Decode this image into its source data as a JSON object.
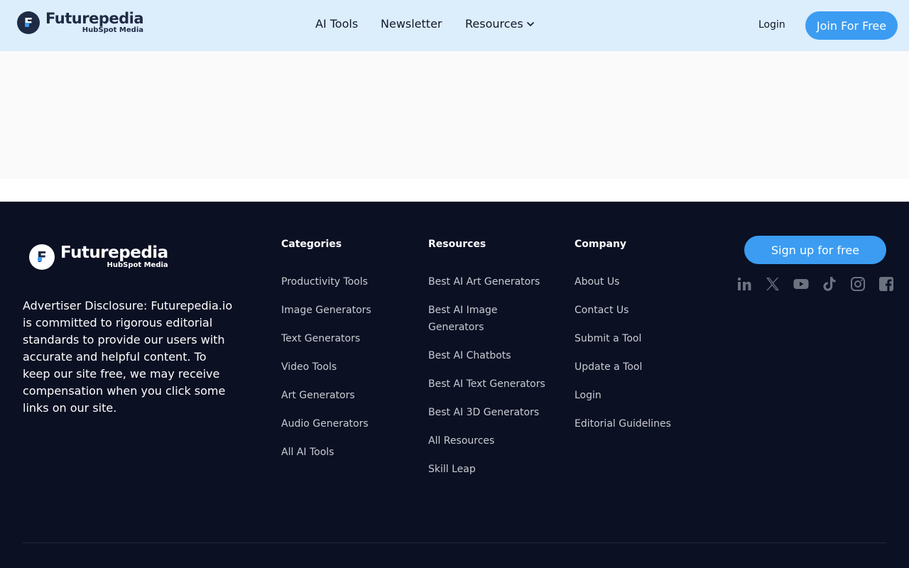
{
  "brand": {
    "name": "Futurepedia",
    "sub": "HubSpot Media",
    "mark": "F"
  },
  "header": {
    "nav": {
      "ai_tools": "AI Tools",
      "newsletter": "Newsletter",
      "resources": "Resources"
    },
    "login": "Login",
    "join": "Join For Free"
  },
  "footer": {
    "disclosure": "Advertiser Disclosure: Futurepedia.io is committed to rigorous editorial standards to provide our users with accurate and helpful content. To keep our site free, we may receive compensation when you click some links on our site.",
    "categories": {
      "heading": "Categories",
      "items": [
        "Productivity Tools",
        "Image Generators",
        "Text Generators",
        "Video Tools",
        "Art Generators",
        "Audio Generators",
        "All AI Tools"
      ]
    },
    "resources": {
      "heading": "Resources",
      "items": [
        "Best AI Art Generators",
        "Best AI Image Generators",
        "Best AI Chatbots",
        "Best AI Text Generators",
        "Best AI 3D Generators",
        "All Resources",
        "Skill Leap"
      ]
    },
    "company": {
      "heading": "Company",
      "items": [
        "About Us",
        "Contact Us",
        "Submit a Tool",
        "Update a Tool",
        "Login",
        "Editorial Guidelines"
      ]
    },
    "signup": "Sign up for free",
    "social_icons": [
      "linkedin-icon",
      "x-icon",
      "youtube-icon",
      "tiktok-icon",
      "instagram-icon",
      "facebook-icon"
    ]
  },
  "colors": {
    "header_bg": "#dcedfc",
    "accent": "#3b9cf2",
    "footer_bg": "#0b1023",
    "brand_dark": "#1f2a44"
  }
}
